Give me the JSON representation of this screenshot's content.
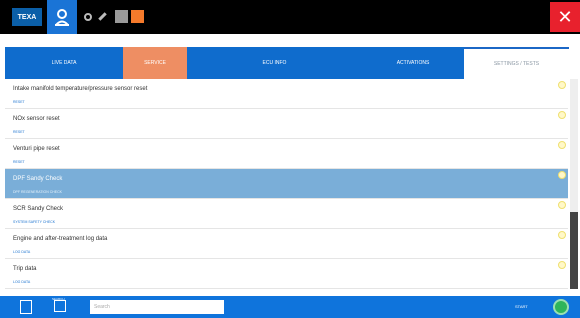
{
  "header": {
    "logo_text": "TEXA",
    "close_label": "✕"
  },
  "tabs": [
    {
      "label": "LIVE DATA"
    },
    {
      "label": "SERVICE"
    },
    {
      "label": "ECU INFO"
    },
    {
      "label": "ACTIVATIONS"
    },
    {
      "label": "SETTINGS / TESTS"
    }
  ],
  "list": {
    "items": [
      {
        "main": "Intake manifold temperature/pressure sensor reset",
        "sub": "RESET"
      },
      {
        "main": "NOx sensor reset",
        "sub": "RESET"
      },
      {
        "main": "Venturi pipe reset",
        "sub": "RESET"
      },
      {
        "main": "DPF Sandy Check",
        "sub": "DPF REGENERATION CHECK"
      },
      {
        "main": "SCR Sandy Check",
        "sub": "SYSTEM SAFETY CHECK"
      },
      {
        "main": "Engine and after-treatment log data",
        "sub": "LOG DATA"
      },
      {
        "main": "Trip data",
        "sub": "LOG DATA"
      }
    ],
    "selected_index": 3
  },
  "footer": {
    "search_placeholder": "Search",
    "secondary_label": "SEARCH",
    "start_label": "START"
  }
}
